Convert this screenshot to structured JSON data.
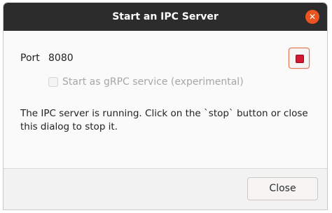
{
  "window": {
    "title": "Start an IPC Server",
    "close_glyph": "✕"
  },
  "port": {
    "label": "Port",
    "value": "8080"
  },
  "stop_button": {
    "icon": "stop-icon",
    "color": "#d3182f"
  },
  "grpc": {
    "label": "Start as gRPC service (experimental)",
    "checked": false,
    "enabled": false
  },
  "status": {
    "message": "The IPC server is running. Click on the `stop` button or close this dialog to stop it."
  },
  "footer": {
    "close_label": "Close"
  },
  "colors": {
    "titlebar": "#2c2c2c",
    "accent": "#e95420"
  }
}
